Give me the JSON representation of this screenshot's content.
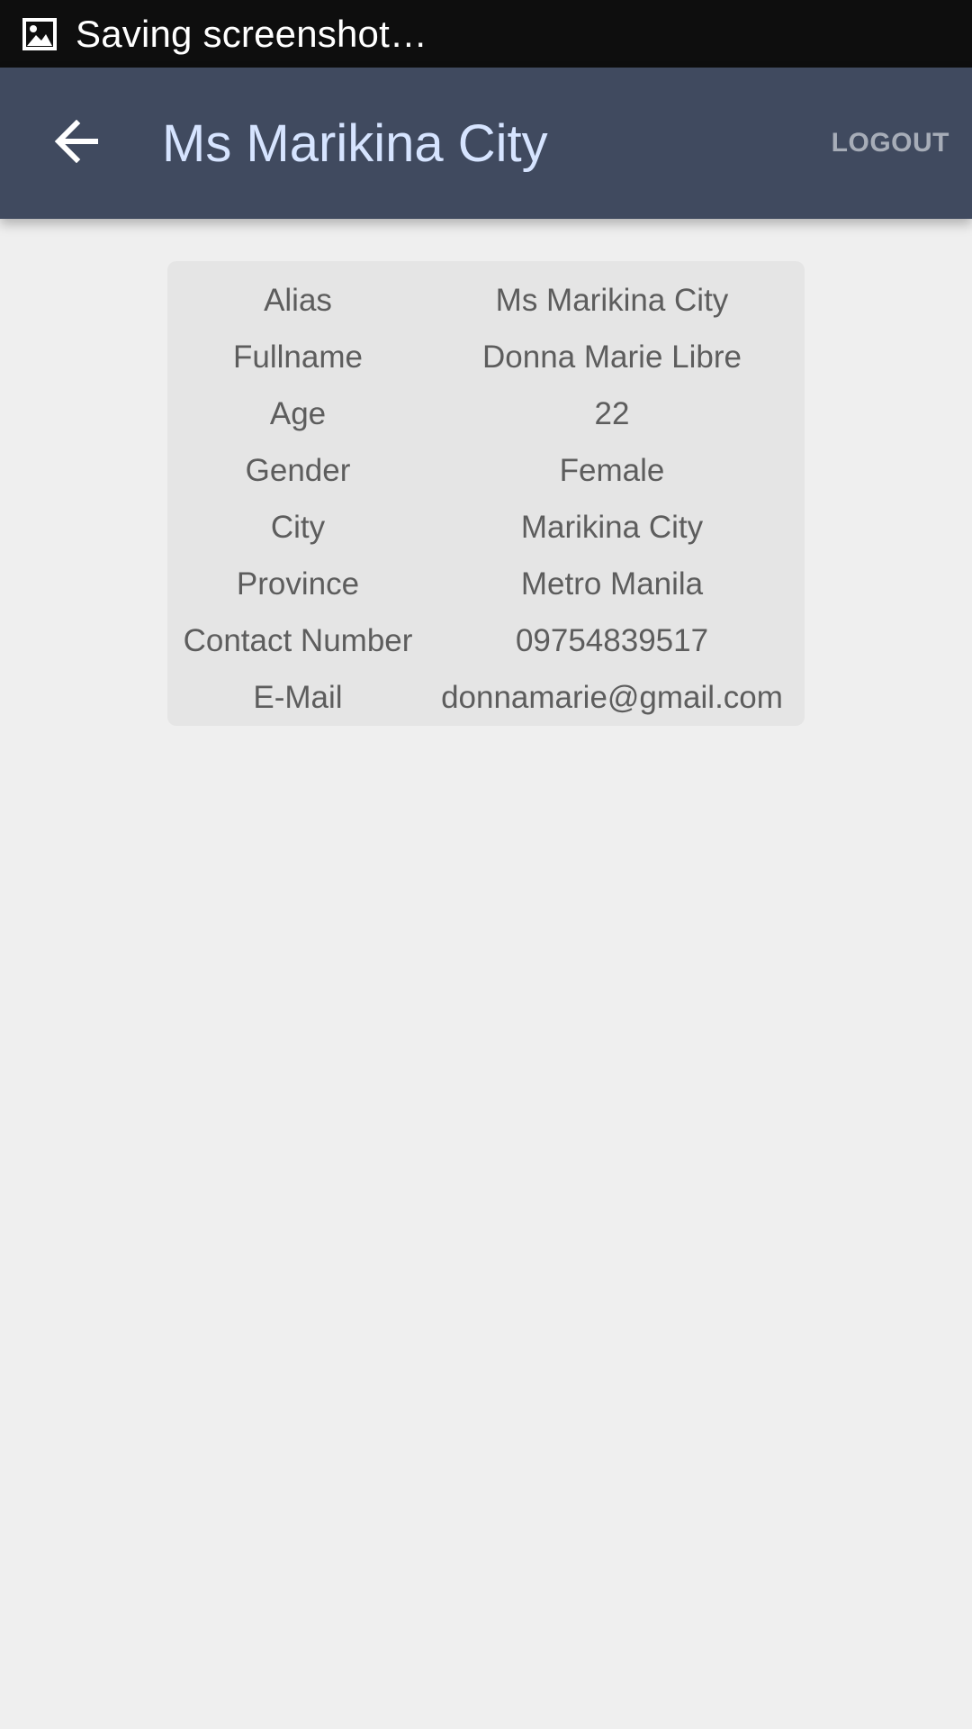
{
  "status_bar": {
    "icon": "image-icon",
    "text": "Saving screenshot…"
  },
  "app_bar": {
    "title": "Ms Marikina City",
    "back_icon": "arrow-left-icon",
    "logout_label": "LOGOUT",
    "background": "#404a5f",
    "title_color": "#d6e4ff"
  },
  "profile": {
    "rows": [
      {
        "label": "Alias",
        "value": "Ms Marikina City"
      },
      {
        "label": "Fullname",
        "value": "Donna Marie Libre"
      },
      {
        "label": "Age",
        "value": "22"
      },
      {
        "label": "Gender",
        "value": "Female"
      },
      {
        "label": "City",
        "value": "Marikina City"
      },
      {
        "label": "Province",
        "value": "Metro Manila"
      },
      {
        "label": "Contact Number",
        "value": "09754839517"
      },
      {
        "label": "E-Mail",
        "value": "donnamarie@gmail.com"
      }
    ]
  }
}
